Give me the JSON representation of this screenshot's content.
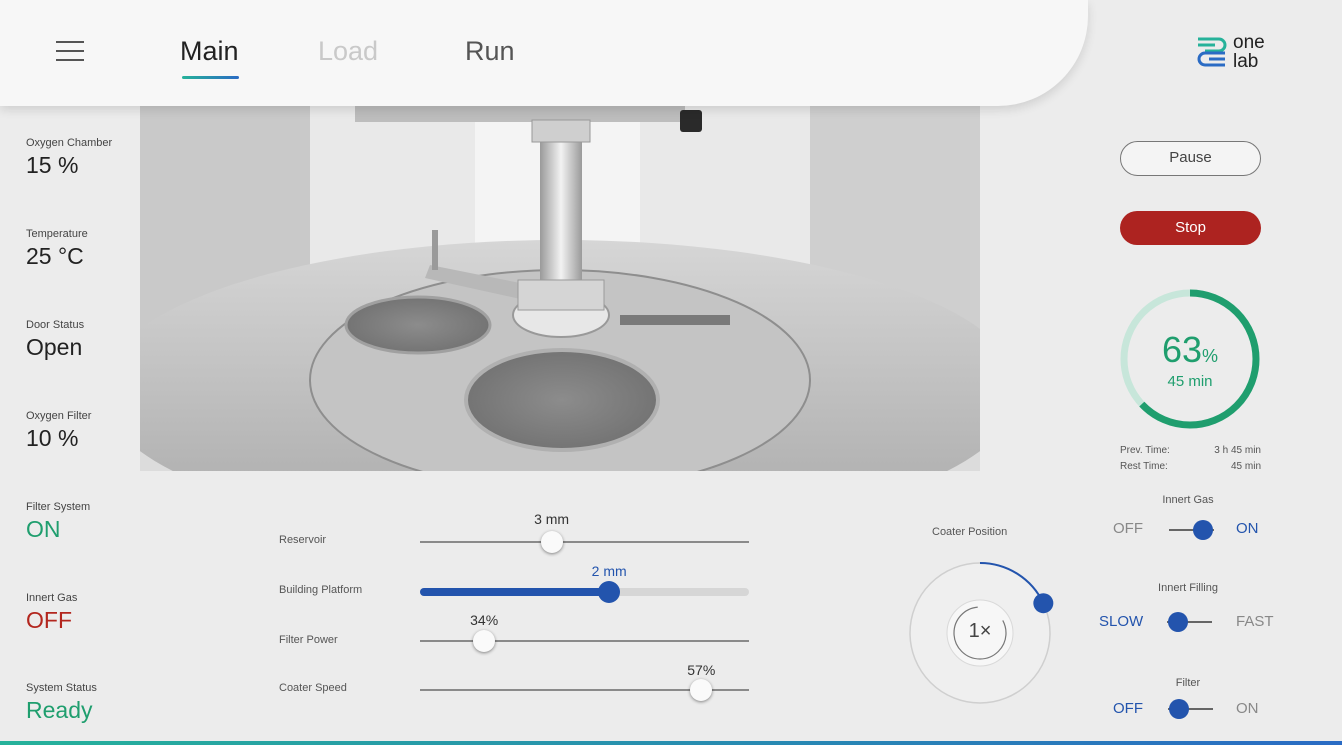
{
  "nav": {
    "menu_icon": "hamburger-menu-icon",
    "tabs": [
      {
        "label": "Main",
        "active": true
      },
      {
        "label": "Load",
        "active": false
      },
      {
        "label": "Run",
        "active": false
      }
    ]
  },
  "logo": {
    "line1": "one",
    "line2": "lab"
  },
  "stats": [
    {
      "label": "Oxygen Chamber",
      "value": "15 %",
      "tone": "default"
    },
    {
      "label": "Temperature",
      "value": "25 °C",
      "tone": "default"
    },
    {
      "label": "Door Status",
      "value": "Open",
      "tone": "default"
    },
    {
      "label": "Oxygen Filter",
      "value": "10 %",
      "tone": "default"
    },
    {
      "label": "Filter System",
      "value": "ON",
      "tone": "green"
    },
    {
      "label": "Innert Gas",
      "value": "OFF",
      "tone": "red"
    },
    {
      "label": "System Status",
      "value": "Ready",
      "tone": "green"
    }
  ],
  "sliders": [
    {
      "label": "Reservoir",
      "value_text": "3 mm",
      "fraction": 0.4,
      "style": "thin"
    },
    {
      "label": "Building Platform",
      "value_text": "2 mm",
      "fraction": 0.575,
      "style": "thick"
    },
    {
      "label": "Filter Power",
      "value_text": "34%",
      "fraction": 0.195,
      "style": "thin"
    },
    {
      "label": "Coater Speed",
      "value_text": "57%",
      "fraction": 0.855,
      "style": "thin"
    }
  ],
  "coater": {
    "label": "Coater Position",
    "button": "1×",
    "position_fraction": 0.18
  },
  "controls": {
    "pause": "Pause",
    "stop": "Stop"
  },
  "progress": {
    "percent": "63",
    "unit": "%",
    "time": "45 min",
    "fraction": 0.63,
    "prev_label": "Prev. Time:",
    "prev_value": "3 h 45 min",
    "rest_label": "Rest Time:",
    "rest_value": "45 min"
  },
  "toggles": [
    {
      "title": "Innert Gas",
      "left": "OFF",
      "right": "ON",
      "state": "right"
    },
    {
      "title": "Innert Filling",
      "left": "SLOW",
      "right": "FAST",
      "state": "left"
    },
    {
      "title": "Filter",
      "left": "OFF",
      "right": "ON",
      "state": "left"
    }
  ],
  "colors": {
    "accent_blue": "#2354ad",
    "accent_green": "#1f9e6e",
    "stop_red": "#ad2320"
  }
}
